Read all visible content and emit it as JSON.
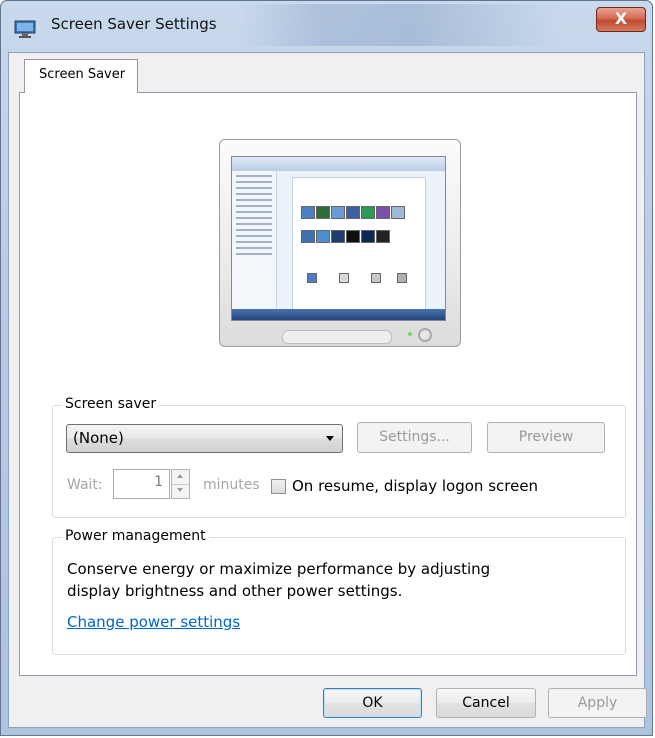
{
  "window": {
    "title": "Screen Saver Settings",
    "close_glyph": "X"
  },
  "tabs": [
    {
      "label": "Screen Saver"
    }
  ],
  "screen_saver": {
    "group_label": "Screen saver",
    "selected": "(None)",
    "settings_label": "Settings...",
    "preview_label": "Preview",
    "wait_label": "Wait:",
    "wait_value": "1",
    "minutes_label": "minutes",
    "resume_label": "On resume, display logon screen",
    "resume_checked": false
  },
  "power": {
    "group_label": "Power management",
    "description": "Conserve energy or maximize performance by adjusting display brightness and other power settings.",
    "link_label": "Change power settings"
  },
  "buttons": {
    "ok": "OK",
    "cancel": "Cancel",
    "apply": "Apply"
  },
  "colors": {
    "link": "#0066cc",
    "close_button": "#c9503a"
  }
}
